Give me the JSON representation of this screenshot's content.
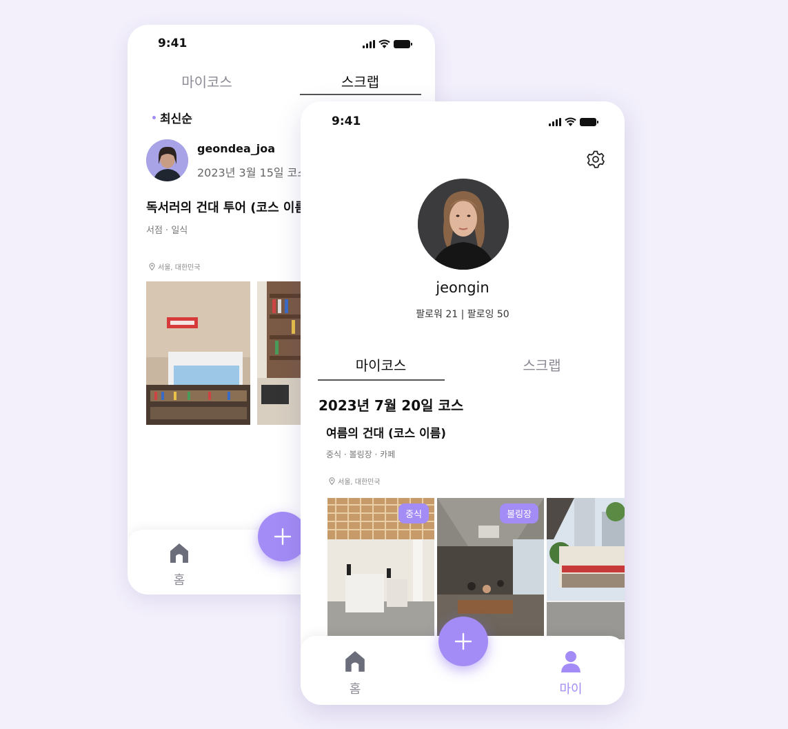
{
  "back_screen": {
    "status_time": "9:41",
    "tabs": [
      {
        "label": "마이코스",
        "active": false
      },
      {
        "label": "스크랩",
        "active": true
      }
    ],
    "sort_label": "최신순",
    "post": {
      "username": "geondea_joa",
      "date_text": "2023년 3월 15일 코스",
      "course_name": "독서러의 건대 투어 (코스 이름)",
      "categories": "서점 · 일식",
      "location": "서울, 대한민국"
    },
    "nav": {
      "home_label": "홈"
    }
  },
  "front_screen": {
    "status_time": "9:41",
    "profile": {
      "username": "jeongin",
      "follow_text": "팔로워 21 | 팔로잉 50"
    },
    "tabs": [
      {
        "label": "마이코스",
        "active": true
      },
      {
        "label": "스크랩",
        "active": false
      }
    ],
    "course_date": "2023년 7월 20일 코스",
    "course_name": "여름의 건대 (코스 이름)",
    "categories": "중식 · 볼링장 · 카페",
    "location": "서울, 대한민국",
    "photo_tags": [
      "중식",
      "볼링장"
    ],
    "nav": {
      "home_label": "홈",
      "my_label": "마이"
    }
  },
  "colors": {
    "background": "#f3f0fc",
    "accent": "#a38cf5",
    "tab_underline": "#555555",
    "muted_text": "#8a8a95"
  },
  "icons": [
    "signal-icon",
    "wifi-icon",
    "battery-icon",
    "gear-icon",
    "location-pin-icon",
    "home-icon",
    "plus-icon",
    "person-icon"
  ]
}
